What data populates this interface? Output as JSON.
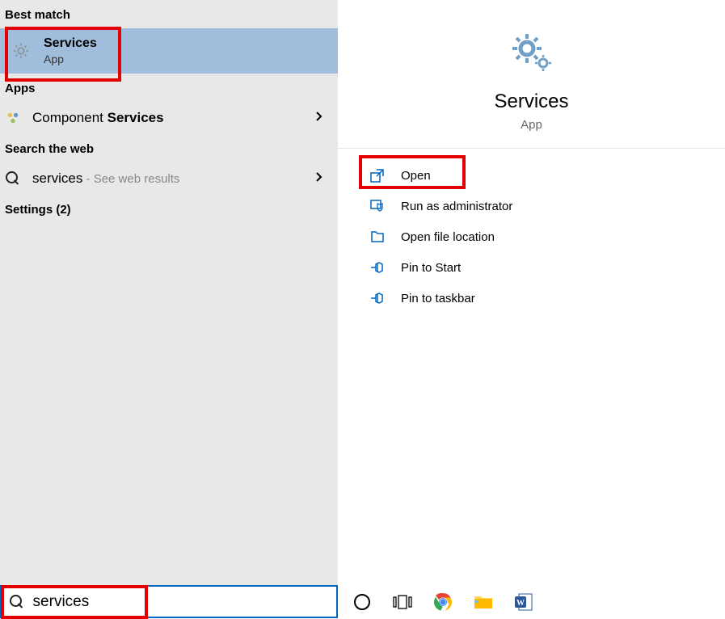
{
  "sections": {
    "best_match": "Best match",
    "apps": "Apps",
    "search_web": "Search the web",
    "settings": "Settings (2)"
  },
  "best_match_item": {
    "title": "Services",
    "subtitle": "App"
  },
  "apps_item": {
    "prefix": "Component ",
    "bold": "Services"
  },
  "web_item": {
    "query": "services",
    "suffix": " - See web results"
  },
  "detail": {
    "title": "Services",
    "subtitle": "App"
  },
  "actions": {
    "open": "Open",
    "run_admin": "Run as administrator",
    "open_location": "Open file location",
    "pin_start": "Pin to Start",
    "pin_taskbar": "Pin to taskbar"
  },
  "search": {
    "value": "services"
  }
}
